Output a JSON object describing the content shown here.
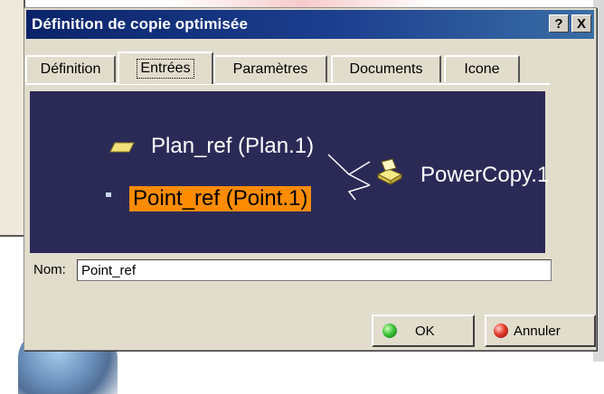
{
  "dialog": {
    "title": "Définition de copie optimisée",
    "help_button": "?",
    "close_button": "X"
  },
  "tabs": [
    {
      "label": "Définition",
      "active": false
    },
    {
      "label": "Entrées",
      "active": true
    },
    {
      "label": "Paramètres",
      "active": false
    },
    {
      "label": "Documents",
      "active": false
    },
    {
      "label": "Icone",
      "active": false
    }
  ],
  "graph": {
    "inputs": [
      {
        "label": "Plan_ref (Plan.1)",
        "icon": "plane-icon",
        "selected": false
      },
      {
        "label": "Point_ref (Point.1)",
        "icon": "point-icon",
        "selected": true
      }
    ],
    "output": {
      "label": "PowerCopy.1",
      "icon": "powercopy-icon"
    },
    "colors": {
      "background": "#2b2a57",
      "selection": "#ff8c00",
      "text": "#ffffff"
    }
  },
  "name_field": {
    "label": "Nom:",
    "value": "Point_ref"
  },
  "buttons": {
    "ok": {
      "label": "OK",
      "icon": "green-led-icon"
    },
    "cancel": {
      "label": "Annuler",
      "icon": "red-led-icon"
    }
  }
}
